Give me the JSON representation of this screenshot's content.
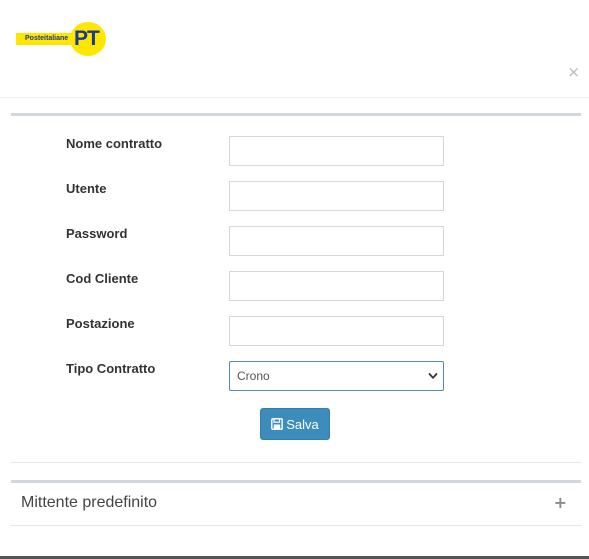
{
  "header": {
    "logo_text": "Posteitaliane",
    "logo_mark": "PT",
    "close_symbol": "×"
  },
  "form": {
    "fields": [
      {
        "label": "Nome contratto",
        "value": ""
      },
      {
        "label": "Utente",
        "value": ""
      },
      {
        "label": "Password",
        "value": ""
      },
      {
        "label": "Cod Cliente",
        "value": ""
      },
      {
        "label": "Postazione",
        "value": ""
      }
    ],
    "contract_type": {
      "label": "Tipo Contratto",
      "selected": "Crono"
    },
    "save_label": "Salva",
    "save_icon": "floppy-disk-icon"
  },
  "sender_panel": {
    "title": "Mittente predefinito",
    "toggle_symbol": "+"
  },
  "colors": {
    "primary_button": "#3c8dbc",
    "logo_yellow": "#ffe600",
    "logo_blue": "#1a3a8f",
    "panel_border": "#d2d6de"
  }
}
